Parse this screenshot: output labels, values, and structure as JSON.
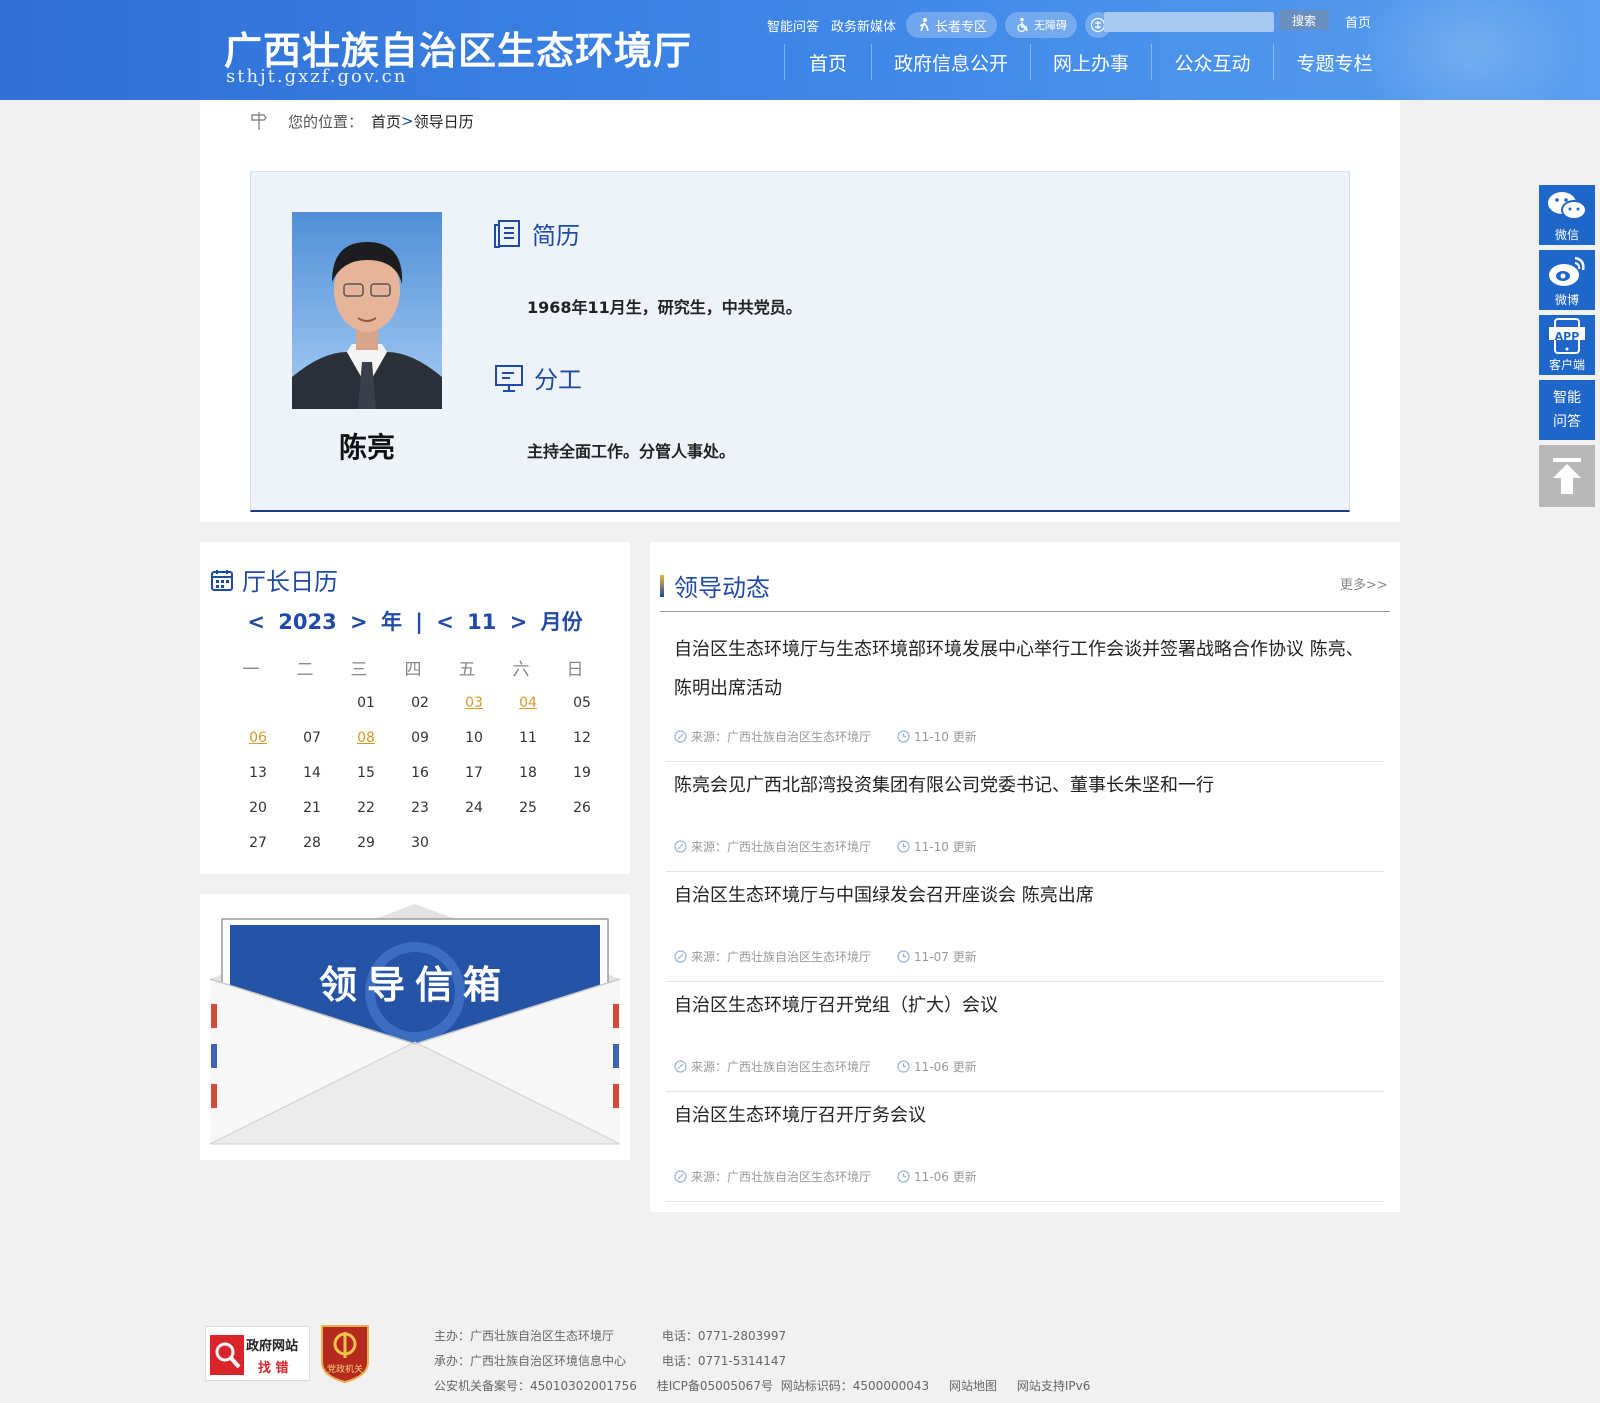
{
  "header": {
    "site_title": "广西壮族自治区生态环境厅",
    "site_domain": "sthjt.gxzf.gov.cn",
    "top_links": [
      "智能问答",
      "政务新媒体"
    ],
    "elder_zone": "长者专区",
    "accessibility": "无障碍",
    "search_placeholder": "",
    "search_button": "搜索",
    "home_link": "首页",
    "nav": [
      "首页",
      "政府信息公开",
      "网上办事",
      "公众互动",
      "专题专栏"
    ]
  },
  "breadcrumb": {
    "label": "您的位置：",
    "home": "首页",
    "separator": ">",
    "current": "领导日历"
  },
  "profile": {
    "name": "陈亮",
    "resume_heading": "简历",
    "resume_text": "1968年11月生，研究生，中共党员。",
    "duty_heading": "分工",
    "duty_text": "主持全面工作。分管人事处。"
  },
  "calendar": {
    "title": "厅长日历",
    "prev": "<",
    "next": ">",
    "year": "2023",
    "year_suffix": "年",
    "divider": "|",
    "month": "11",
    "month_suffix": "月份",
    "weekdays": [
      "一",
      "二",
      "三",
      "四",
      "五",
      "六",
      "日"
    ],
    "days": [
      "",
      "",
      "01",
      "02",
      "03",
      "04",
      "05",
      "06",
      "07",
      "08",
      "09",
      "10",
      "11",
      "12",
      "13",
      "14",
      "15",
      "16",
      "17",
      "18",
      "19",
      "20",
      "21",
      "22",
      "23",
      "24",
      "25",
      "26",
      "27",
      "28",
      "29",
      "30"
    ],
    "highlighted_days": [
      "03",
      "04",
      "06",
      "08"
    ]
  },
  "mailbox": {
    "label": "领导信箱"
  },
  "news": {
    "title": "领导动态",
    "more": "更多>>",
    "items": [
      {
        "title": "自治区生态环境厅与生态环境部环境发展中心举行工作会谈并签署战略合作协议 陈亮、陈明出席活动",
        "source": "来源：广西壮族自治区生态环境厅",
        "date": "11-10 更新"
      },
      {
        "title": "陈亮会见广西北部湾投资集团有限公司党委书记、董事长朱坚和一行",
        "source": "来源：广西壮族自治区生态环境厅",
        "date": "11-10 更新"
      },
      {
        "title": "自治区生态环境厅与中国绿发会召开座谈会 陈亮出席",
        "source": "来源：广西壮族自治区生态环境厅",
        "date": "11-07 更新"
      },
      {
        "title": "自治区生态环境厅召开党组（扩大）会议",
        "source": "来源：广西壮族自治区生态环境厅",
        "date": "11-06 更新"
      },
      {
        "title": "自治区生态环境厅召开厅务会议",
        "source": "来源：广西壮族自治区生态环境厅",
        "date": "11-06 更新"
      }
    ]
  },
  "side": {
    "wechat": "微信",
    "weibo": "微博",
    "app": "客户端",
    "app_badge": "APP",
    "qa_line1": "智能",
    "qa_line2": "问答"
  },
  "footer": {
    "badge_line1": "政府网站",
    "badge_line2": "找 错",
    "party_badge": "党政机关",
    "host": "主办：广西壮族自治区生态环境厅",
    "host_tel": "电话：0771-2803997",
    "undertaker": "承办：广西壮族自治区环境信息中心",
    "undertaker_tel": "电话：0771-5314147",
    "police_record": "公安机关备案号：45010302001756",
    "icp": "桂ICP备05005067号",
    "site_id": "网站标识码：4500000043",
    "sitemap": "网站地图",
    "ipv6": "网站支持IPv6"
  },
  "colors": {
    "header_blue": "#3f88e8",
    "heading_blue": "#1f4aa8",
    "highlight_day": "#d59a2a",
    "side_blue": "#1e66c8"
  }
}
